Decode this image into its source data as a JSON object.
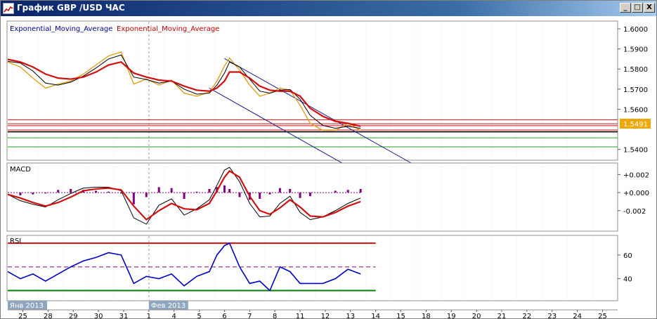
{
  "window": {
    "title": "График GBP /USD ЧАС",
    "minimize_glyph": "_",
    "maximize_glyph": "□",
    "close_glyph": "X",
    "icon": "chart-icon"
  },
  "colors": {
    "price": "#e0a020",
    "ema_fast": "#000000",
    "ema_slow": "#d01010",
    "macd_hist": "#800080",
    "signal": "#d01010",
    "rsi": "#0000c0",
    "rsi_upper": "#d01010",
    "rsi_lower": "#008000",
    "rsi_mid": "#800080",
    "channel": "#1a1a8c",
    "hline_red": "#d01010",
    "hline_green": "#20a020",
    "price_label_bg": "#f0a800",
    "date_label_bg": "#8fa6c0"
  },
  "chart_data": [
    {
      "type": "line",
      "panel": "price",
      "legend": [
        "Exponential_Moving_Average",
        "Exponential_Moving_Average"
      ],
      "ylim": [
        1.535,
        1.6035
      ],
      "y_ticks": [
        "1.6000",
        "1.5900",
        "1.5800",
        "1.5700",
        "1.5600",
        "1.5400"
      ],
      "current_price": "1.5491",
      "x": [
        0,
        0.5,
        1,
        1.5,
        2,
        2.5,
        3,
        3.5,
        4,
        4.5,
        5,
        5.5,
        6,
        6.5,
        7,
        7.5,
        8,
        8.3,
        8.6,
        8.8,
        9.2,
        9.6,
        10,
        10.4,
        10.8,
        11.2,
        11.6,
        12,
        12.5,
        13,
        13.5,
        14
      ],
      "series": [
        {
          "role": "price",
          "values": [
            1.5835,
            1.581,
            1.5755,
            1.5705,
            1.5725,
            1.574,
            1.5775,
            1.582,
            1.5865,
            1.5885,
            1.5725,
            1.575,
            1.572,
            1.5745,
            1.568,
            1.5665,
            1.5685,
            1.574,
            1.5815,
            1.5855,
            1.5795,
            1.572,
            1.5665,
            1.568,
            1.5705,
            1.5695,
            1.562,
            1.553,
            1.5495,
            1.5495,
            1.553,
            1.5495
          ]
        },
        {
          "role": "ema_fast",
          "values": [
            1.5838,
            1.583,
            1.579,
            1.573,
            1.572,
            1.5735,
            1.5765,
            1.5805,
            1.585,
            1.587,
            1.576,
            1.5748,
            1.573,
            1.574,
            1.57,
            1.5675,
            1.568,
            1.572,
            1.578,
            1.5835,
            1.581,
            1.575,
            1.569,
            1.568,
            1.5695,
            1.5698,
            1.565,
            1.557,
            1.552,
            1.5505,
            1.5515,
            1.5505
          ]
        },
        {
          "role": "ema_slow",
          "values": [
            1.5848,
            1.5835,
            1.581,
            1.5775,
            1.5755,
            1.575,
            1.576,
            1.5785,
            1.582,
            1.5835,
            1.578,
            1.576,
            1.5745,
            1.574,
            1.5715,
            1.5695,
            1.569,
            1.5705,
            1.574,
            1.5785,
            1.5785,
            1.5755,
            1.5715,
            1.5695,
            1.569,
            1.569,
            1.5665,
            1.5605,
            1.5565,
            1.554,
            1.553,
            1.5515
          ]
        }
      ],
      "horizontal_lines": [
        {
          "color": "hline_red",
          "value": 1.5548
        },
        {
          "color": "hline_red",
          "value": 1.5528
        },
        {
          "color": "hline_red",
          "value": 1.5518
        },
        {
          "color": "hline_red",
          "value": 1.5497
        },
        {
          "color": "ema_fast",
          "value": 1.5488
        },
        {
          "color": "hline_green",
          "value": 1.5458
        },
        {
          "color": "hline_green",
          "value": 1.5413
        }
      ],
      "channel": [
        {
          "x1": 8.6,
          "y1": 1.5852,
          "x2": 16.4,
          "y2": 1.5305
        },
        {
          "x1": 8.0,
          "y1": 1.5705,
          "x2": 13.3,
          "y2": 1.533
        }
      ]
    },
    {
      "type": "bar",
      "panel": "macd",
      "legend": [
        "MACD"
      ],
      "ylim": [
        -0.0042,
        0.0032
      ],
      "y_ticks": [
        "+0.002",
        "+0.000",
        "-0.002"
      ],
      "x": [
        0,
        0.5,
        1,
        1.5,
        2,
        2.5,
        3,
        3.5,
        4,
        4.5,
        5,
        5.5,
        6,
        6.5,
        7,
        7.5,
        8,
        8.3,
        8.6,
        8.8,
        9.2,
        9.6,
        10,
        10.4,
        10.8,
        11.2,
        11.6,
        12,
        12.5,
        13,
        13.5,
        14
      ],
      "series": [
        {
          "role": "macd",
          "values": [
            -0.0002,
            -0.0009,
            -0.0013,
            -0.0016,
            -0.0008,
            -0.0001,
            0.0005,
            0.0006,
            0.0006,
            0.0002,
            -0.0028,
            -0.0035,
            -0.0014,
            -0.0007,
            -0.0025,
            -0.0018,
            -0.0008,
            0.0008,
            0.0025,
            0.0028,
            0.0012,
            -0.0012,
            -0.0027,
            -0.0026,
            -0.0012,
            -0.0004,
            -0.0022,
            -0.003,
            -0.0027,
            -0.002,
            -0.0012,
            -0.0006
          ]
        },
        {
          "role": "signal",
          "values": [
            -0.0002,
            -0.0006,
            -0.0011,
            -0.0015,
            -0.0011,
            -0.0005,
            0.0002,
            0.0004,
            0.0005,
            0.0003,
            -0.0015,
            -0.003,
            -0.002,
            -0.0012,
            -0.0018,
            -0.0019,
            -0.0012,
            0.0002,
            0.0017,
            0.0024,
            0.0017,
            -0.0004,
            -0.002,
            -0.0024,
            -0.0017,
            -0.0008,
            -0.0016,
            -0.0026,
            -0.0027,
            -0.0022,
            -0.0015,
            -0.001
          ]
        },
        {
          "role": "histogram",
          "values": [
            0.0,
            -0.0003,
            -0.0002,
            -0.0001,
            0.0003,
            0.0004,
            0.0003,
            0.0002,
            0.0001,
            -0.0001,
            -0.0013,
            -0.0005,
            0.0006,
            0.0005,
            -0.0007,
            0.0001,
            0.0004,
            0.0006,
            0.0008,
            0.0004,
            -0.0005,
            -0.0008,
            -0.0007,
            -0.0002,
            0.0005,
            0.0004,
            -0.0006,
            -0.0004,
            0.0,
            0.0002,
            0.0003,
            0.0004
          ]
        }
      ]
    },
    {
      "type": "line",
      "panel": "rsi",
      "legend": [
        "RSI"
      ],
      "ylim": [
        22,
        76
      ],
      "y_ticks": [
        "60",
        "40"
      ],
      "levels": [
        70,
        50,
        30
      ],
      "x": [
        0,
        0.5,
        1,
        1.5,
        2,
        2.5,
        3,
        3.5,
        4,
        4.5,
        5,
        5.5,
        6,
        6.5,
        7,
        7.5,
        8,
        8.3,
        8.6,
        8.8,
        9.2,
        9.6,
        10,
        10.4,
        10.8,
        11.2,
        11.6,
        12,
        12.5,
        13,
        13.5,
        14
      ],
      "series": [
        {
          "role": "rsi",
          "values": [
            46,
            40,
            44,
            38,
            44,
            50,
            55,
            58,
            62,
            60,
            36,
            42,
            40,
            44,
            34,
            42,
            46,
            60,
            68,
            70,
            50,
            36,
            38,
            30,
            50,
            46,
            36,
            36,
            36,
            40,
            48,
            44
          ]
        }
      ]
    }
  ],
  "x_axis": {
    "labels": [
      {
        "text": "25",
        "x": 0.6
      },
      {
        "text": "28",
        "x": 1.6
      },
      {
        "text": "29",
        "x": 2.6
      },
      {
        "text": "30",
        "x": 3.6
      },
      {
        "text": "31",
        "x": 4.6
      },
      {
        "text": "1",
        "x": 5.6
      },
      {
        "text": "4",
        "x": 6.6
      },
      {
        "text": "5",
        "x": 7.6
      },
      {
        "text": "6",
        "x": 8.6
      },
      {
        "text": "7",
        "x": 9.6
      },
      {
        "text": "8",
        "x": 10.6
      },
      {
        "text": "11",
        "x": 11.6
      },
      {
        "text": "12",
        "x": 12.6
      },
      {
        "text": "13",
        "x": 13.6
      },
      {
        "text": "14",
        "x": 14.6
      },
      {
        "text": "15",
        "x": 15.6
      },
      {
        "text": "18",
        "x": 16.6
      },
      {
        "text": "19",
        "x": 17.6
      },
      {
        "text": "20",
        "x": 18.6
      },
      {
        "text": "21",
        "x": 19.6
      },
      {
        "text": "22",
        "x": 20.6
      },
      {
        "text": "23",
        "x": 21.6
      },
      {
        "text": "24",
        "x": 22.6
      },
      {
        "text": "25",
        "x": 23.6
      }
    ],
    "month_labels": [
      {
        "text": "Янв 2013",
        "x": 0.0
      },
      {
        "text": "Фев 2013",
        "x": 5.6
      }
    ],
    "month_separator_x": 5.6
  }
}
